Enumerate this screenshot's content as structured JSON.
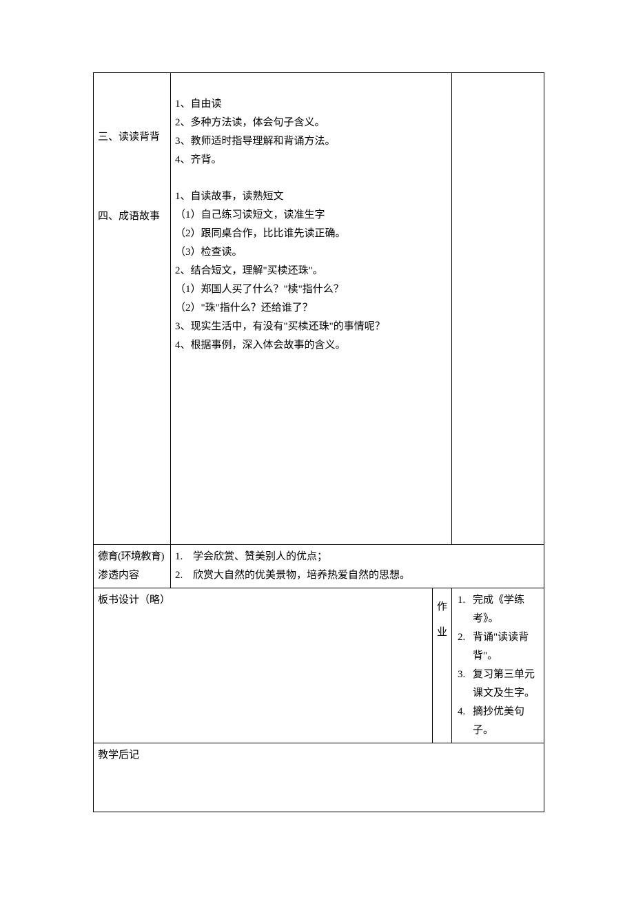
{
  "row1": {
    "labels": {
      "section3": "三、读读背背",
      "section4": "四、成语故事"
    },
    "section3_lines": [
      "1、自由读",
      "2、多种方法读，体会句子含义。",
      "3、教师适时指导理解和背诵方法。",
      "4、齐背。"
    ],
    "section4_lines": [
      "1、自读故事，读熟短文",
      "（1）自己练习读短文，读准生字",
      "（2）跟同桌合作，比比谁先读正确。",
      "（3）检查读。",
      "2、结合短文，理解\"买椟还珠\"。",
      "（1）郑国人买了什么？\"椟\"指什么？",
      "（2）\"珠\"指什么？还给谁了？",
      "3、现实生活中，有没有\"买椟还珠\"的事情呢？",
      "4、根据事例，深入体会故事的含义。"
    ]
  },
  "row2": {
    "label_line1": "德育(环境教育)",
    "label_line2": "渗透内容",
    "items": [
      {
        "num": "1.",
        "text": "学会欣赏、赞美别人的优点；"
      },
      {
        "num": "2.",
        "text": "欣赏大自然的优美景物，培养热爱自然的思想。"
      }
    ]
  },
  "row3": {
    "left_label": "板书设计（略）",
    "hw_label_c1": "作",
    "hw_label_c2": "业",
    "hw_items": [
      {
        "num": "1.",
        "text": "完成《学练考》。"
      },
      {
        "num": "2.",
        "text": "背诵\"读读背背\"。"
      },
      {
        "num": "3.",
        "text": "复习第三单元课文及生字。"
      },
      {
        "num": "4.",
        "text": "摘抄优美句子。"
      }
    ]
  },
  "row4": {
    "label": "教学后记"
  }
}
